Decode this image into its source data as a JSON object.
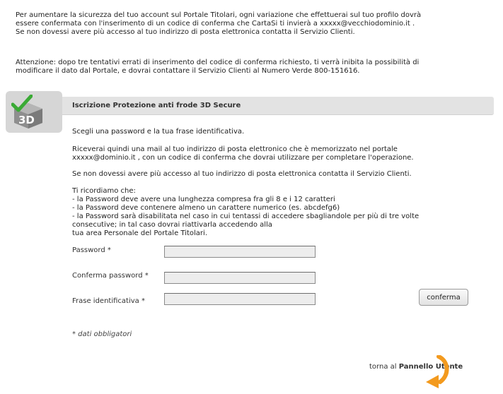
{
  "intro": {
    "line1": "Per aumentare la sicurezza del tuo account sul Portale Titolari, ogni variazione che effettuerai sul tuo profilo dovrà",
    "line2": "essere confermata con l'inserimento di un codice di conferma che CartaSi ti invierà a xxxxx@vecchiodominio.it .",
    "line3": "Se non dovessi avere più accesso al tuo indirizzo di posta elettronica contatta il Servizio Clienti."
  },
  "warning": {
    "line1": "Attenzione: dopo tre tentativi errati di inserimento del codice di conferma richiesto, ti verrà inibita la possibilità di",
    "line2": "modificare il dato dal Portale, e dovrai contattare il Servizio Clienti al Numero Verde 800-151616."
  },
  "logo": {
    "text": "3D",
    "check_color": "#3aaa35",
    "cube_color": "#9c9c9c"
  },
  "section": {
    "title": "Iscrizione Protezione anti frode 3D Secure"
  },
  "content": {
    "p1": "Scegli una password e la tua frase identificativa.",
    "p2_line1": "Riceverai quindi una mail al tuo indirizzo di posta elettronico che è memorizzato nel portale",
    "p2_line2": "xxxxx@dominio.it , con un codice di conferma che dovrai utilizzare per completare l'operazione.",
    "p3": "Se non dovessi avere più accesso al tuo indirizzo di posta elettronica contatta il Servizio Clienti.",
    "reminder_title": "Ti ricordiamo che:",
    "rule1": "- la Password deve avere una lunghezza compresa fra gli 8 e i 12 caratteri",
    "rule2": "- la Password deve contenere almeno un carattere numerico (es. abcdefg6)",
    "rule3_line1": "- la Password sarà disabilitata nel caso in cui tentassi di accedere sbagliandole per più di tre volte",
    "rule3_line2": "consecutive; in tal caso dovrai riattivarla accedendo alla",
    "rule3_line3": "tua area Personale del Portale Titolari."
  },
  "form": {
    "password_label": "Password *",
    "password_value": "",
    "confirm_label": "Conferma password *",
    "confirm_value": "",
    "phrase_label": "Frase identificativa *",
    "phrase_value": "",
    "submit_label": "conferma",
    "required_note": "* dati obbligatori"
  },
  "footer": {
    "back_prefix": "torna al",
    "back_link": "Pannello Utente",
    "arrow_color": "#f39a1e"
  }
}
